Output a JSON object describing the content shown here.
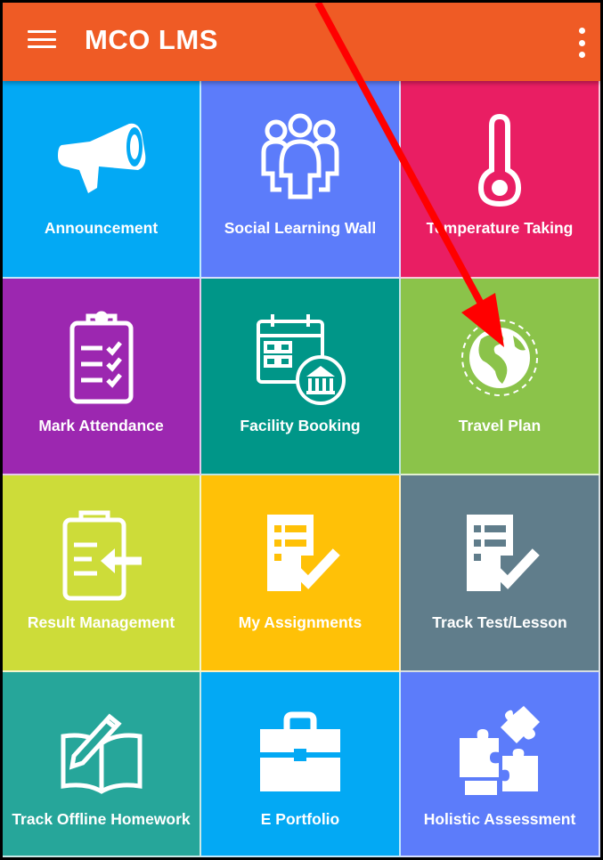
{
  "appbar": {
    "title": "MCO LMS",
    "menu_icon": "hamburger-menu-icon",
    "overflow_icon": "more-vert-icon",
    "color": "#ef5b25"
  },
  "tiles": [
    {
      "label": "Announcement",
      "icon": "megaphone-icon",
      "color": "#03a9f4"
    },
    {
      "label": "Social Learning Wall",
      "icon": "group-icon",
      "color": "#5c7cfa"
    },
    {
      "label": "Temperature Taking",
      "icon": "thermometer-icon",
      "color": "#e91e63"
    },
    {
      "label": "Mark Attendance",
      "icon": "clipboard-checklist-icon",
      "color": "#9c27b0"
    },
    {
      "label": "Facility Booking",
      "icon": "calendar-building-icon",
      "color": "#009688"
    },
    {
      "label": "Travel Plan",
      "icon": "globe-icon",
      "color": "#8bc34a"
    },
    {
      "label": "Result Management",
      "icon": "clipboard-import-icon",
      "color": "#cddc39"
    },
    {
      "label": "My Assignments",
      "icon": "document-check-icon",
      "color": "#ffc107"
    },
    {
      "label": "Track Test/Lesson",
      "icon": "document-check-icon",
      "color": "#607d8b"
    },
    {
      "label": "Track Offline Homework",
      "icon": "book-pen-icon",
      "color": "#26a69a"
    },
    {
      "label": "E Portfolio",
      "icon": "briefcase-icon",
      "color": "#03a9f4"
    },
    {
      "label": "Holistic Assessment",
      "icon": "puzzle-icon",
      "color": "#5c7cfa"
    }
  ],
  "annotation": {
    "arrow_color": "#ff0000"
  }
}
